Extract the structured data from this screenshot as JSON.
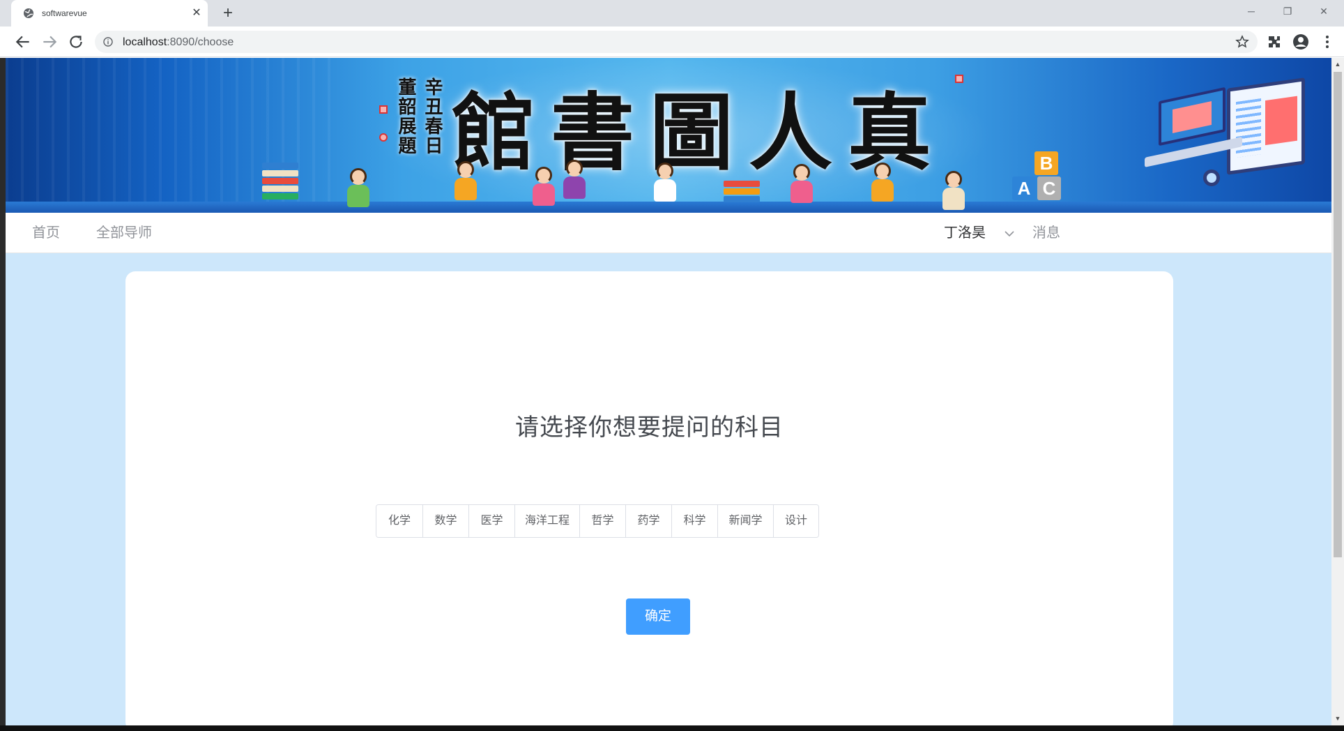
{
  "browser": {
    "tab_title": "softwarevue",
    "url_host": "localhost",
    "url_path": ":8090/choose",
    "icons": [
      "globe-icon",
      "close-icon",
      "plus-icon",
      "back-icon",
      "forward-icon",
      "reload-icon",
      "info-icon",
      "star-icon",
      "extensions-icon",
      "profile-icon",
      "menu-icon"
    ]
  },
  "banner": {
    "calligraphy_title": "館書圖人真",
    "signature_line1": "辛丑春日",
    "signature_line2": "董韶展題"
  },
  "navbar": {
    "home": "首页",
    "all_mentors": "全部导师",
    "username": "丁洛昊",
    "messages": "消息"
  },
  "main": {
    "prompt": "请选择你想要提问的科目",
    "subjects": [
      "化学",
      "数学",
      "医学",
      "海洋工程",
      "哲学",
      "药学",
      "科学",
      "新闻学",
      "设计"
    ],
    "confirm_label": "确定"
  },
  "colors": {
    "page_background": "#cde7fb",
    "primary_button": "#409eff",
    "nav_text": "#909399"
  }
}
